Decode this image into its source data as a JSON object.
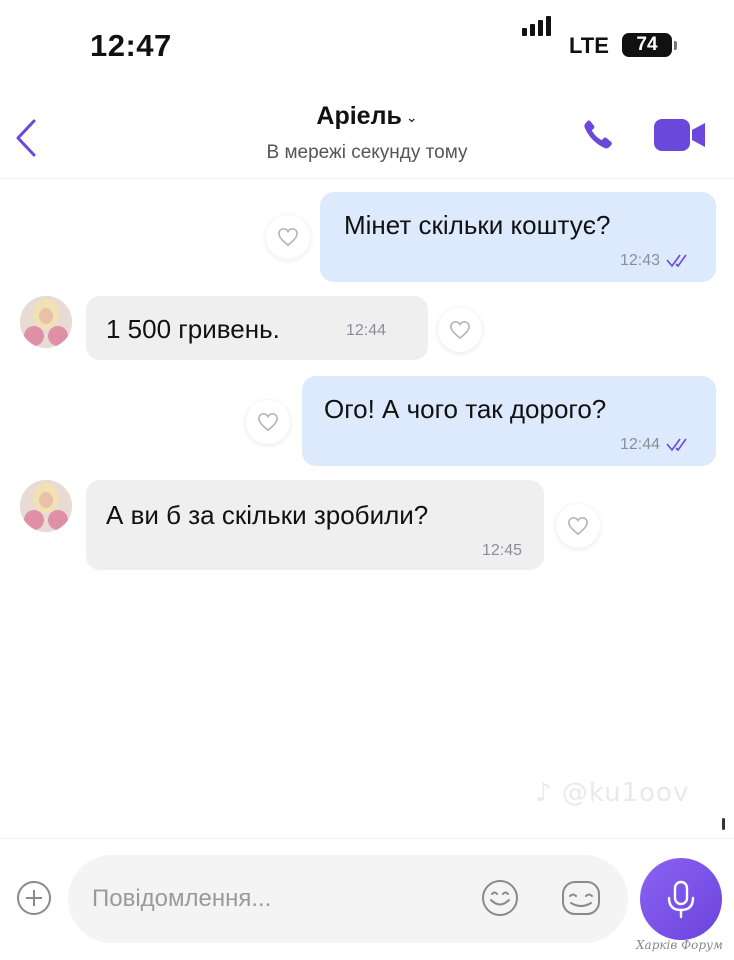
{
  "status_bar": {
    "time": "12:47",
    "network": "LTE",
    "battery": "74"
  },
  "header": {
    "contact_name": "Аріель",
    "chevron": "⌄",
    "status": "В мережі секунду тому",
    "icons": {
      "back": "chevron-left-icon",
      "call": "phone-icon",
      "video": "video-camera-icon"
    },
    "accent_color": "#6b47dc"
  },
  "messages": [
    {
      "direction": "outgoing",
      "text": "Мінет скільки коштує?",
      "time": "12:43",
      "read": true
    },
    {
      "direction": "incoming",
      "text": "1 500 гривень.",
      "time": "12:44"
    },
    {
      "direction": "outgoing",
      "text": "Ого! А чого так дорого?",
      "time": "12:44",
      "read": true
    },
    {
      "direction": "incoming",
      "text": "А ви б за скільки зробили?",
      "time": "12:45"
    }
  ],
  "watermark": "♪ @ku1oov",
  "composer": {
    "placeholder": "Повідомлення...",
    "icons": {
      "add": "plus-circle-icon",
      "emoji": "smiley-icon",
      "sticker": "sticker-icon",
      "mic": "microphone-icon"
    }
  },
  "forum_watermark": "Харків Форум",
  "colors": {
    "outgoing_bubble": "#ddeafd",
    "incoming_bubble": "#efefef",
    "mic_button": "#7a52e8"
  }
}
